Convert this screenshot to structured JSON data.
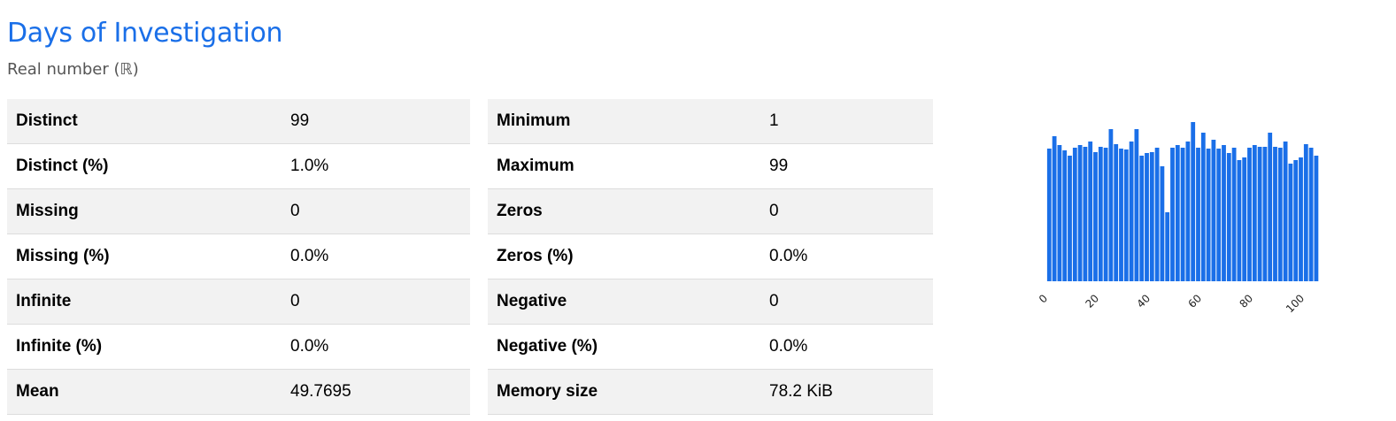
{
  "header": {
    "title": "Days of Investigation",
    "subtitle": "Real number (ℝ)"
  },
  "stats_left": [
    {
      "label": "Distinct",
      "value": "99"
    },
    {
      "label": "Distinct (%)",
      "value": "1.0%"
    },
    {
      "label": "Missing",
      "value": "0"
    },
    {
      "label": "Missing (%)",
      "value": "0.0%"
    },
    {
      "label": "Infinite",
      "value": "0"
    },
    {
      "label": "Infinite (%)",
      "value": "0.0%"
    },
    {
      "label": "Mean",
      "value": "49.7695"
    }
  ],
  "stats_right": [
    {
      "label": "Minimum",
      "value": "1"
    },
    {
      "label": "Maximum",
      "value": "99"
    },
    {
      "label": "Zeros",
      "value": "0"
    },
    {
      "label": "Zeros (%)",
      "value": "0.0%"
    },
    {
      "label": "Negative",
      "value": "0"
    },
    {
      "label": "Negative (%)",
      "value": "0.0%"
    },
    {
      "label": "Memory size",
      "value": "78.2 KiB"
    }
  ],
  "chart_data": {
    "type": "bar",
    "title": "",
    "xlabel": "",
    "ylabel": "",
    "xlim": [
      0,
      100
    ],
    "xticks": [
      "0",
      "20",
      "40",
      "60",
      "80",
      "100"
    ],
    "bar_color": "#1a6fe8",
    "bin_edges_start": 1,
    "bin_width": 2,
    "values": [
      150,
      164,
      154,
      148,
      142,
      151,
      154,
      152,
      158,
      146,
      152,
      151,
      172,
      155,
      150,
      149,
      158,
      172,
      142,
      145,
      146,
      151,
      130,
      78,
      151,
      154,
      151,
      158,
      180,
      151,
      168,
      150,
      160,
      150,
      154,
      145,
      151,
      137,
      140,
      151,
      154,
      152,
      152,
      168,
      152,
      151,
      158,
      133,
      137,
      140,
      155,
      151,
      142
    ],
    "grid": false,
    "legend": "none"
  }
}
